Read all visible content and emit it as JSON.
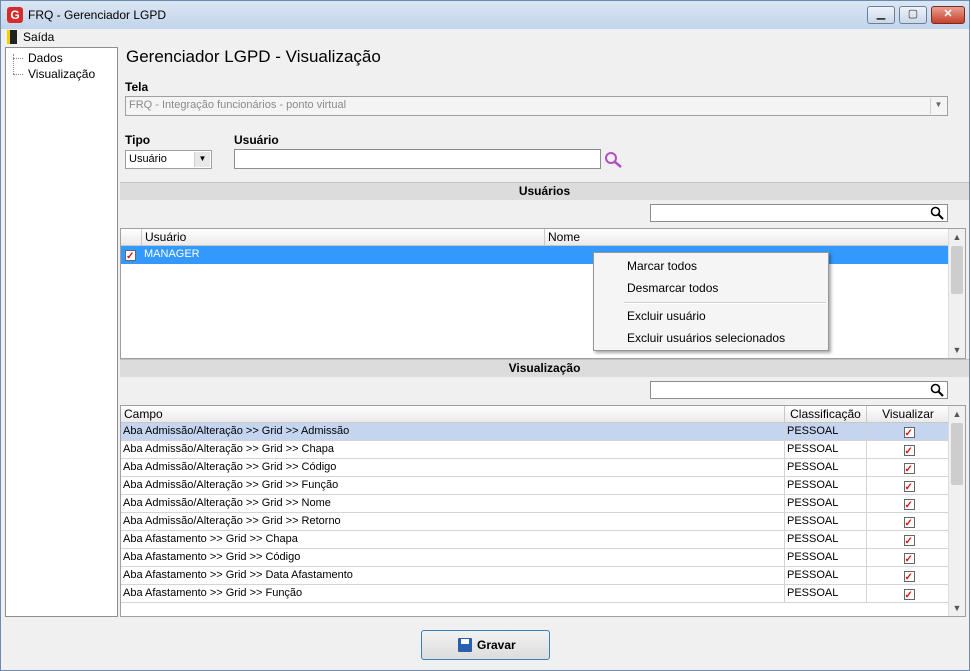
{
  "window": {
    "title": "FRQ - Gerenciador LGPD",
    "app_icon": "G",
    "minimize": "▁",
    "maximize": "▢",
    "close": "✕"
  },
  "menu": {
    "exit_label": "Saída"
  },
  "tree": {
    "items": [
      "Dados",
      "Visualização"
    ]
  },
  "page_title": "Gerenciador LGPD - Visualização",
  "tela": {
    "label": "Tela",
    "value": "FRQ - Integração funcionários - ponto virtual"
  },
  "tipo": {
    "label": "Tipo",
    "value": "Usuário"
  },
  "usuario": {
    "label": "Usuário",
    "value": ""
  },
  "usuarios_section": {
    "header": "Usuários",
    "search_value": "",
    "columns": [
      "Usuário",
      "Nome"
    ],
    "rows": [
      {
        "checked": true,
        "usuario": "MANAGER",
        "nome": ""
      }
    ]
  },
  "context_menu": {
    "items": [
      "Marcar todos",
      "Desmarcar todos",
      "Excluir usuário",
      "Excluir usuários selecionados"
    ]
  },
  "visualizacao_section": {
    "header": "Visualização",
    "search_value": "",
    "columns": [
      "Campo",
      "Classificação",
      "Visualizar"
    ],
    "rows": [
      {
        "campo": "Aba Admissão/Alteração >> Grid >> Admissão",
        "classificacao": "PESSOAL",
        "visualizar": true
      },
      {
        "campo": "Aba Admissão/Alteração >> Grid >> Chapa",
        "classificacao": "PESSOAL",
        "visualizar": true
      },
      {
        "campo": "Aba Admissão/Alteração >> Grid >> Código",
        "classificacao": "PESSOAL",
        "visualizar": true
      },
      {
        "campo": "Aba Admissão/Alteração >> Grid >> Função",
        "classificacao": "PESSOAL",
        "visualizar": true
      },
      {
        "campo": "Aba Admissão/Alteração >> Grid >> Nome",
        "classificacao": "PESSOAL",
        "visualizar": true
      },
      {
        "campo": "Aba Admissão/Alteração >> Grid >> Retorno",
        "classificacao": "PESSOAL",
        "visualizar": true
      },
      {
        "campo": "Aba Afastamento >> Grid >> Chapa",
        "classificacao": "PESSOAL",
        "visualizar": true
      },
      {
        "campo": "Aba Afastamento >> Grid >> Código",
        "classificacao": "PESSOAL",
        "visualizar": true
      },
      {
        "campo": "Aba Afastamento >> Grid >> Data Afastamento",
        "classificacao": "PESSOAL",
        "visualizar": true
      },
      {
        "campo": "Aba Afastamento >> Grid >> Função",
        "classificacao": "PESSOAL",
        "visualizar": true
      }
    ]
  },
  "save_button": {
    "label": "Gravar"
  },
  "colors": {
    "selection": "#3399ff",
    "selected_row": "#c5d5f0",
    "check": "#dd1111",
    "search_icon_purple": "#b24fc4"
  }
}
